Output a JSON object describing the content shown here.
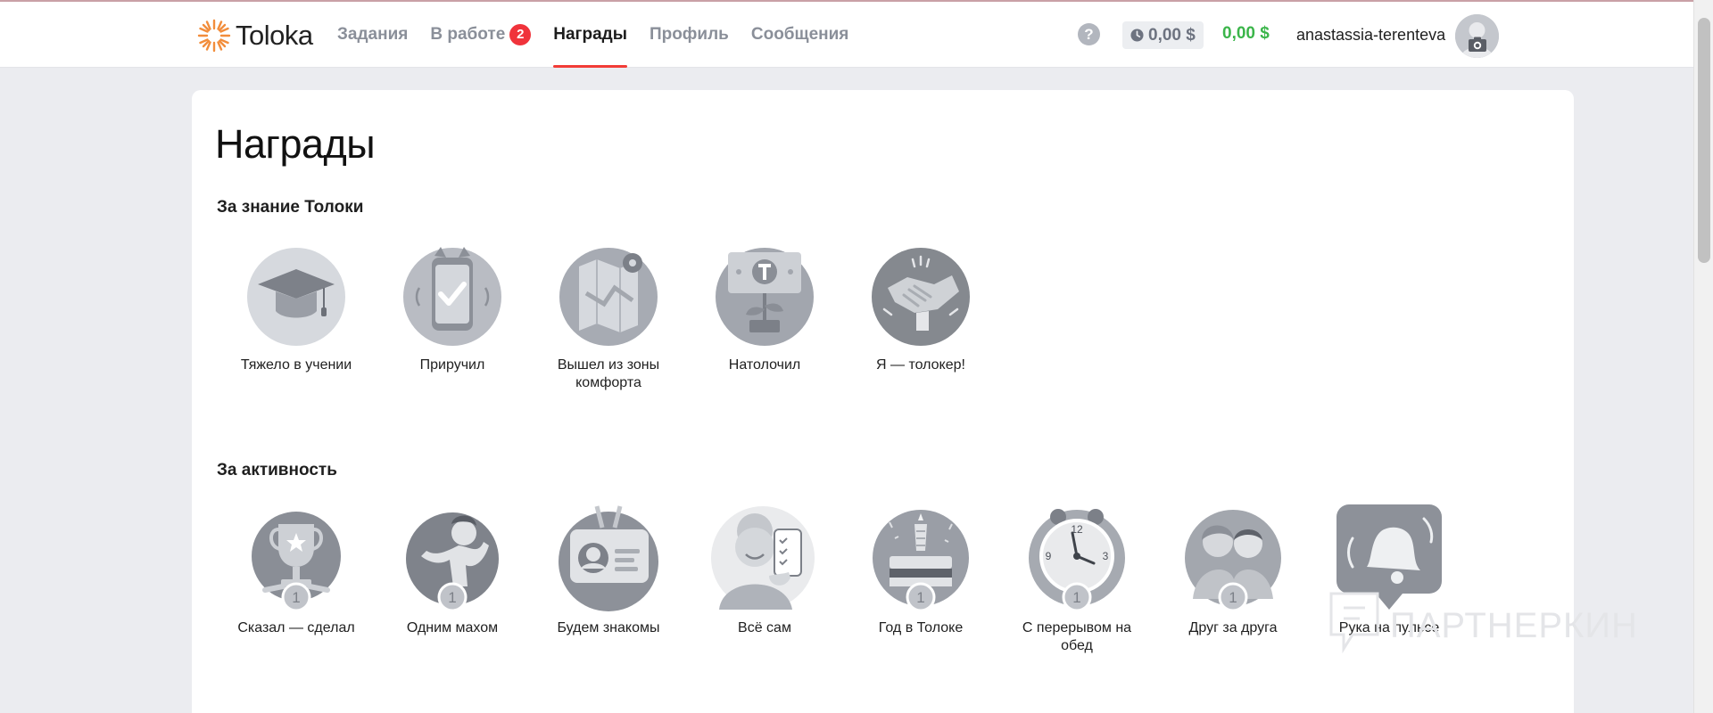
{
  "app": {
    "logo_text": "Toloka"
  },
  "nav": {
    "items": [
      {
        "label": "Задания"
      },
      {
        "label": "В работе",
        "badge": "2"
      },
      {
        "label": "Награды"
      },
      {
        "label": "Профиль"
      },
      {
        "label": "Сообщения"
      }
    ],
    "active_index": 2
  },
  "account": {
    "help_glyph": "?",
    "pending_balance": "0,00 $",
    "balance": "0,00 $",
    "username": "anastassia-terenteva"
  },
  "page": {
    "title": "Награды"
  },
  "sections": [
    {
      "title": "За знание Толоки",
      "awards": [
        {
          "label": "Тяжело в учении",
          "icon": "graduation-cap-icon"
        },
        {
          "label": "Приручил",
          "icon": "phone-check-icon"
        },
        {
          "label": "Вышел из зоны комфорта",
          "icon": "map-icon"
        },
        {
          "label": "Натолочил",
          "icon": "money-plant-icon"
        },
        {
          "label": "Я — толокер!",
          "icon": "handshake-icon"
        }
      ]
    },
    {
      "title": "За активность",
      "awards": [
        {
          "label": "Сказал — сделал",
          "icon": "trophy-icon",
          "level": "1"
        },
        {
          "label": "Одним махом",
          "icon": "runner-icon",
          "level": "1"
        },
        {
          "label": "Будем знакомы",
          "icon": "id-badge-icon"
        },
        {
          "label": "Всё сам",
          "icon": "grandma-phone-icon"
        },
        {
          "label": "Год в Толоке",
          "icon": "birthday-cake-icon",
          "level": "1"
        },
        {
          "label": "С перерывом на обед",
          "icon": "alarm-clock-icon",
          "level": "1"
        },
        {
          "label": "Друг за друга",
          "icon": "friends-icon",
          "level": "1"
        },
        {
          "label": "Рука на пульсе",
          "icon": "bell-icon"
        }
      ]
    }
  ],
  "watermark": {
    "text": "ПАРТНЕРКИН"
  },
  "colors": {
    "accent_red": "#f23c37",
    "badge_red": "#f0333b",
    "balance_green": "#3bb54a",
    "icon_gray": "#9ea2aa",
    "logo_orange": "#f28d3b"
  }
}
